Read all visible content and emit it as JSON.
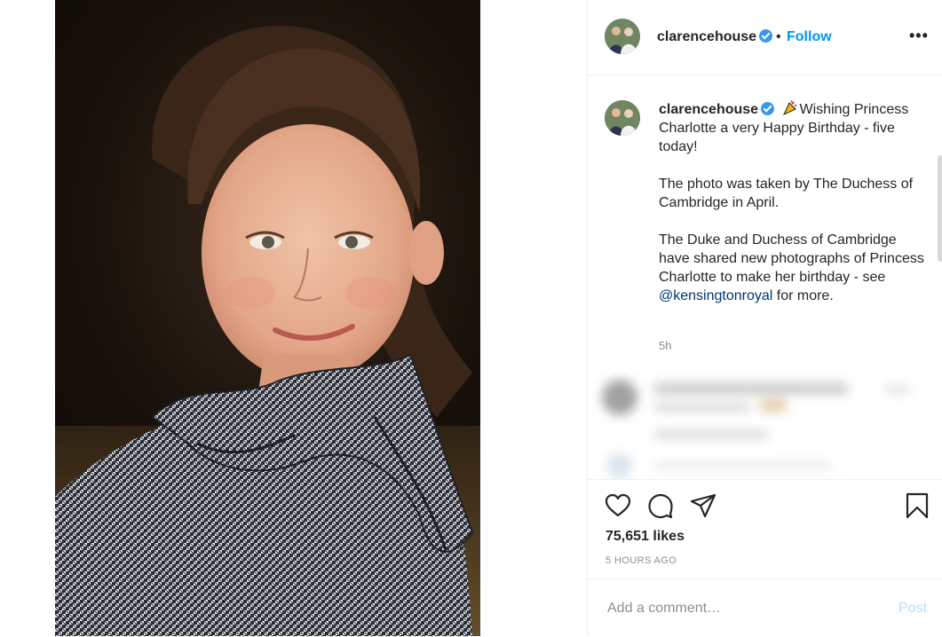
{
  "post": {
    "username": "clarencehouse",
    "separator": "•",
    "follow_label": "Follow",
    "more_label": "•••"
  },
  "caption": {
    "username": "clarencehouse",
    "line1": "Wishing Princess Charlotte a very Happy Birthday - five today!",
    "line2": "The photo was taken by The Duchess of Cambridge in April.",
    "line3_before": "The Duke and Duchess of Cambridge have shared new photographs of Princess Charlotte to make her birthday - see ",
    "mention": "@kensingtonroyal",
    "line3_after": " for more.",
    "time": "5h"
  },
  "stats": {
    "likes": "75,651 likes",
    "posted": "5 HOURS AGO"
  },
  "comment_box": {
    "placeholder": "Add a comment…",
    "post_label": "Post"
  },
  "icons": {
    "like": "heart-icon",
    "comment": "speech-bubble-icon",
    "share": "paper-plane-icon",
    "save": "bookmark-icon",
    "verified": "verified-badge-icon",
    "emoji": "party-popper-icon"
  },
  "colors": {
    "accent": "#0095f6",
    "verified": "#3897f0",
    "mention": "#00376b",
    "muted": "#8e8e8e",
    "post_disabled": "#b2dffc"
  }
}
